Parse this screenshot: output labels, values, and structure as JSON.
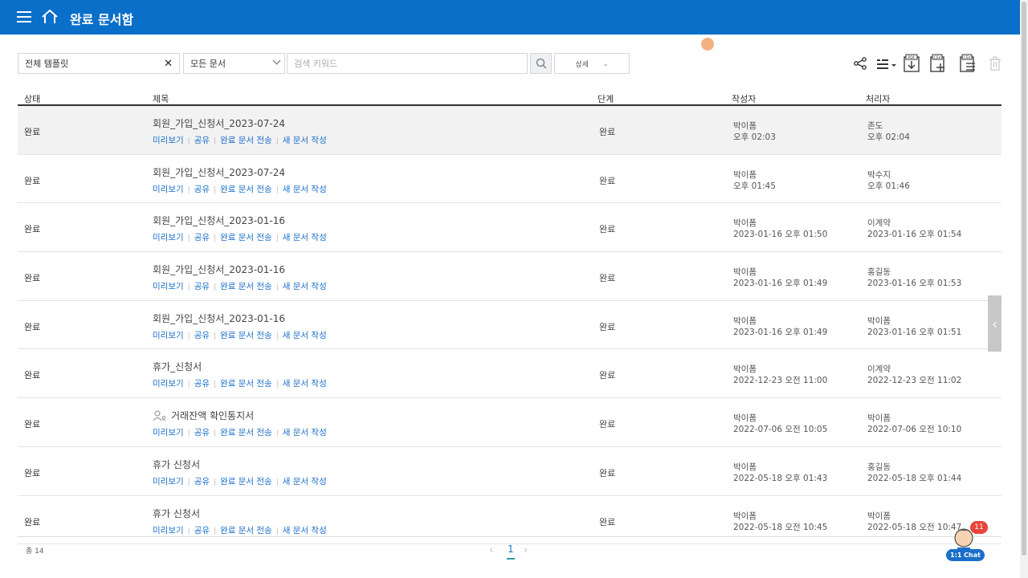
{
  "header": {
    "title": "완료 문서함"
  },
  "filters": {
    "template": "전체 템플릿",
    "doc_type": "모든 문서",
    "search_placeholder": "검색 키워드",
    "detail": "상세"
  },
  "table": {
    "headers": {
      "status": "상태",
      "title": "제목",
      "stage": "단계",
      "author": "작성자",
      "processor": "처리자"
    },
    "action_labels": {
      "preview": "미리보기",
      "share": "공유",
      "send": "완료 문서 전송",
      "new_doc": "새 문서 작성"
    },
    "rows": [
      {
        "status": "완료",
        "title": "회원_가입_신청서_2023-07-24",
        "stage": "완료",
        "author": "박이폼",
        "author_time": "오후 02:03",
        "processor": "존도",
        "processor_time": "오후 02:04",
        "selected": true
      },
      {
        "status": "완료",
        "title": "회원_가입_신청서_2023-07-24",
        "stage": "완료",
        "author": "박이폼",
        "author_time": "오후 01:45",
        "processor": "박수지",
        "processor_time": "오후 01:46"
      },
      {
        "status": "완료",
        "title": "회원_가입_신청서_2023-01-16",
        "stage": "완료",
        "author": "박이폼",
        "author_time": "2023-01-16 오후 01:50",
        "processor": "이계약",
        "processor_time": "2023-01-16 오후 01:54"
      },
      {
        "status": "완료",
        "title": "회원_가입_신청서_2023-01-16",
        "stage": "완료",
        "author": "박이폼",
        "author_time": "2023-01-16 오후 01:49",
        "processor": "홍길동",
        "processor_time": "2023-01-16 오후 01:53"
      },
      {
        "status": "완료",
        "title": "회원_가입_신청서_2023-01-16",
        "stage": "완료",
        "author": "박이폼",
        "author_time": "2023-01-16 오후 01:49",
        "processor": "박이폼",
        "processor_time": "2023-01-16 오후 01:51"
      },
      {
        "status": "완료",
        "title": "휴가_신청서",
        "stage": "완료",
        "author": "박이폼",
        "author_time": "2022-12-23 오전 11:00",
        "processor": "이계약",
        "processor_time": "2022-12-23 오전 11:02"
      },
      {
        "status": "완료",
        "title": "거래잔액 확인통지서",
        "stage": "완료",
        "author": "박이폼",
        "author_time": "2022-07-06 오전 10:05",
        "processor": "박이폼",
        "processor_time": "2022-07-06 오전 10:10",
        "shared_icon": true
      },
      {
        "status": "완료",
        "title": "휴가 신청서",
        "stage": "완료",
        "author": "박이폼",
        "author_time": "2022-05-18 오후 01:43",
        "processor": "홍길동",
        "processor_time": "2022-05-18 오후 01:44"
      },
      {
        "status": "완료",
        "title": "휴가 신청서",
        "stage": "완료",
        "author": "박이폼",
        "author_time": "2022-05-18 오전 10:45",
        "processor": "박이폼",
        "processor_time": "2022-05-18 오전 10:47"
      }
    ]
  },
  "footer": {
    "total": "총 14",
    "current_page": "1"
  },
  "chat": {
    "badge": "11",
    "label": "1:1 Chat"
  },
  "toolbar_icons": [
    "share-icon",
    "column-settings-icon",
    "pdf-download-icon",
    "csv-add-icon",
    "csv-list-icon",
    "trash-icon"
  ],
  "colors": {
    "header_bg": "#0a6fc8",
    "link": "#1a6fc9",
    "badge": "#e8453c"
  }
}
